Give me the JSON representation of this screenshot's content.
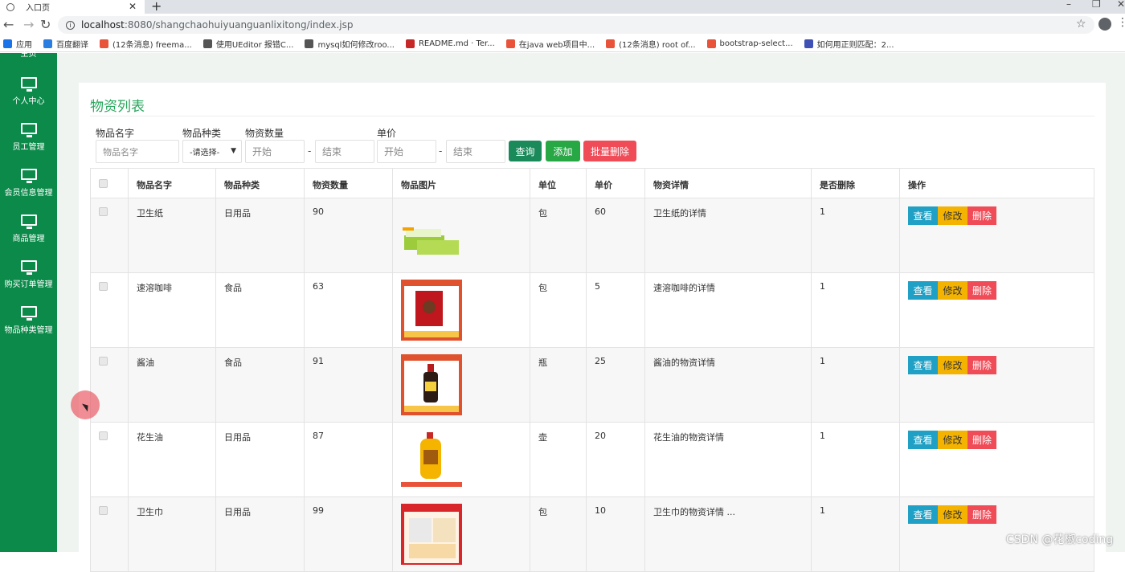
{
  "browser": {
    "tab_title": "入口页",
    "url_host": "localhost",
    "url_path": ":8080/shangchaohuiyuanguanlixitong/index.jsp",
    "bookmarks": [
      {
        "label": "应用",
        "color": "#1a73e8"
      },
      {
        "label": "百度翻译",
        "color": "#2a7de1"
      },
      {
        "label": "(12条消息) freema...",
        "color": "#e8533a"
      },
      {
        "label": "使用UEditor 报错C...",
        "color": "#555555"
      },
      {
        "label": "mysql如何修改roo...",
        "color": "#555555"
      },
      {
        "label": "README.md · Ter...",
        "color": "#c62828"
      },
      {
        "label": "在java web项目中...",
        "color": "#e8533a"
      },
      {
        "label": "(12条消息) root of...",
        "color": "#e8533a"
      },
      {
        "label": "bootstrap-select...",
        "color": "#e8533a"
      },
      {
        "label": "如何用正则匹配：2...",
        "color": "#3f51b5"
      }
    ]
  },
  "sidebar": {
    "top_partial": "主页",
    "items": [
      {
        "label": "个人中心"
      },
      {
        "label": "员工管理"
      },
      {
        "label": "会员信息管理"
      },
      {
        "label": "商品管理"
      },
      {
        "label": "购买订单管理"
      },
      {
        "label": "物品种类管理"
      }
    ]
  },
  "page": {
    "title": "物资列表",
    "filters": {
      "name_label": "物品名字",
      "name_placeholder": "物品名字",
      "type_label": "物品种类",
      "type_selected": "-请选择-",
      "qty_label": "物资数量",
      "qty_start": "开始",
      "qty_end": "结束",
      "price_label": "单价",
      "price_start": "开始",
      "price_end": "结束",
      "dash": "-"
    },
    "buttons": {
      "search": "查询",
      "add": "添加",
      "batch_delete": "批量删除"
    },
    "colors": {
      "sidebar": "#0c8a4a",
      "title": "#29a55c",
      "search_btn": "#1a8a5a",
      "add_btn": "#28a745",
      "delete_btn": "#ef4c58",
      "view_btn": "#1fa0c4",
      "edit_btn": "#f4b300"
    }
  },
  "table": {
    "headers": [
      "",
      "物品名字",
      "物品种类",
      "物资数量",
      "物品图片",
      "单位",
      "单价",
      "物资详情",
      "是否删除",
      "操作"
    ],
    "action_labels": {
      "view": "查看",
      "edit": "修改",
      "delete": "删除"
    },
    "rows": [
      {
        "name": "卫生纸",
        "type": "日用品",
        "qty": "90",
        "image": "tissue",
        "unit": "包",
        "price": "60",
        "detail": "卫生纸的详情",
        "deleted": "1"
      },
      {
        "name": "速溶咖啡",
        "type": "食品",
        "qty": "63",
        "image": "coffee",
        "unit": "包",
        "price": "5",
        "detail": "速溶咖啡的详情",
        "deleted": "1"
      },
      {
        "name": "酱油",
        "type": "食品",
        "qty": "91",
        "image": "soy-sauce",
        "unit": "瓶",
        "price": "25",
        "detail": "酱油的物资详情",
        "deleted": "1"
      },
      {
        "name": "花生油",
        "type": "日用品",
        "qty": "87",
        "image": "peanut-oil",
        "unit": "壶",
        "price": "20",
        "detail": "花生油的物资详情",
        "deleted": "1"
      },
      {
        "name": "卫生巾",
        "type": "日用品",
        "qty": "99",
        "image": "pads",
        "unit": "包",
        "price": "10",
        "detail": "卫生巾的物资详情 ...",
        "deleted": "1"
      }
    ]
  },
  "watermark": "CSDN @花椒coding"
}
